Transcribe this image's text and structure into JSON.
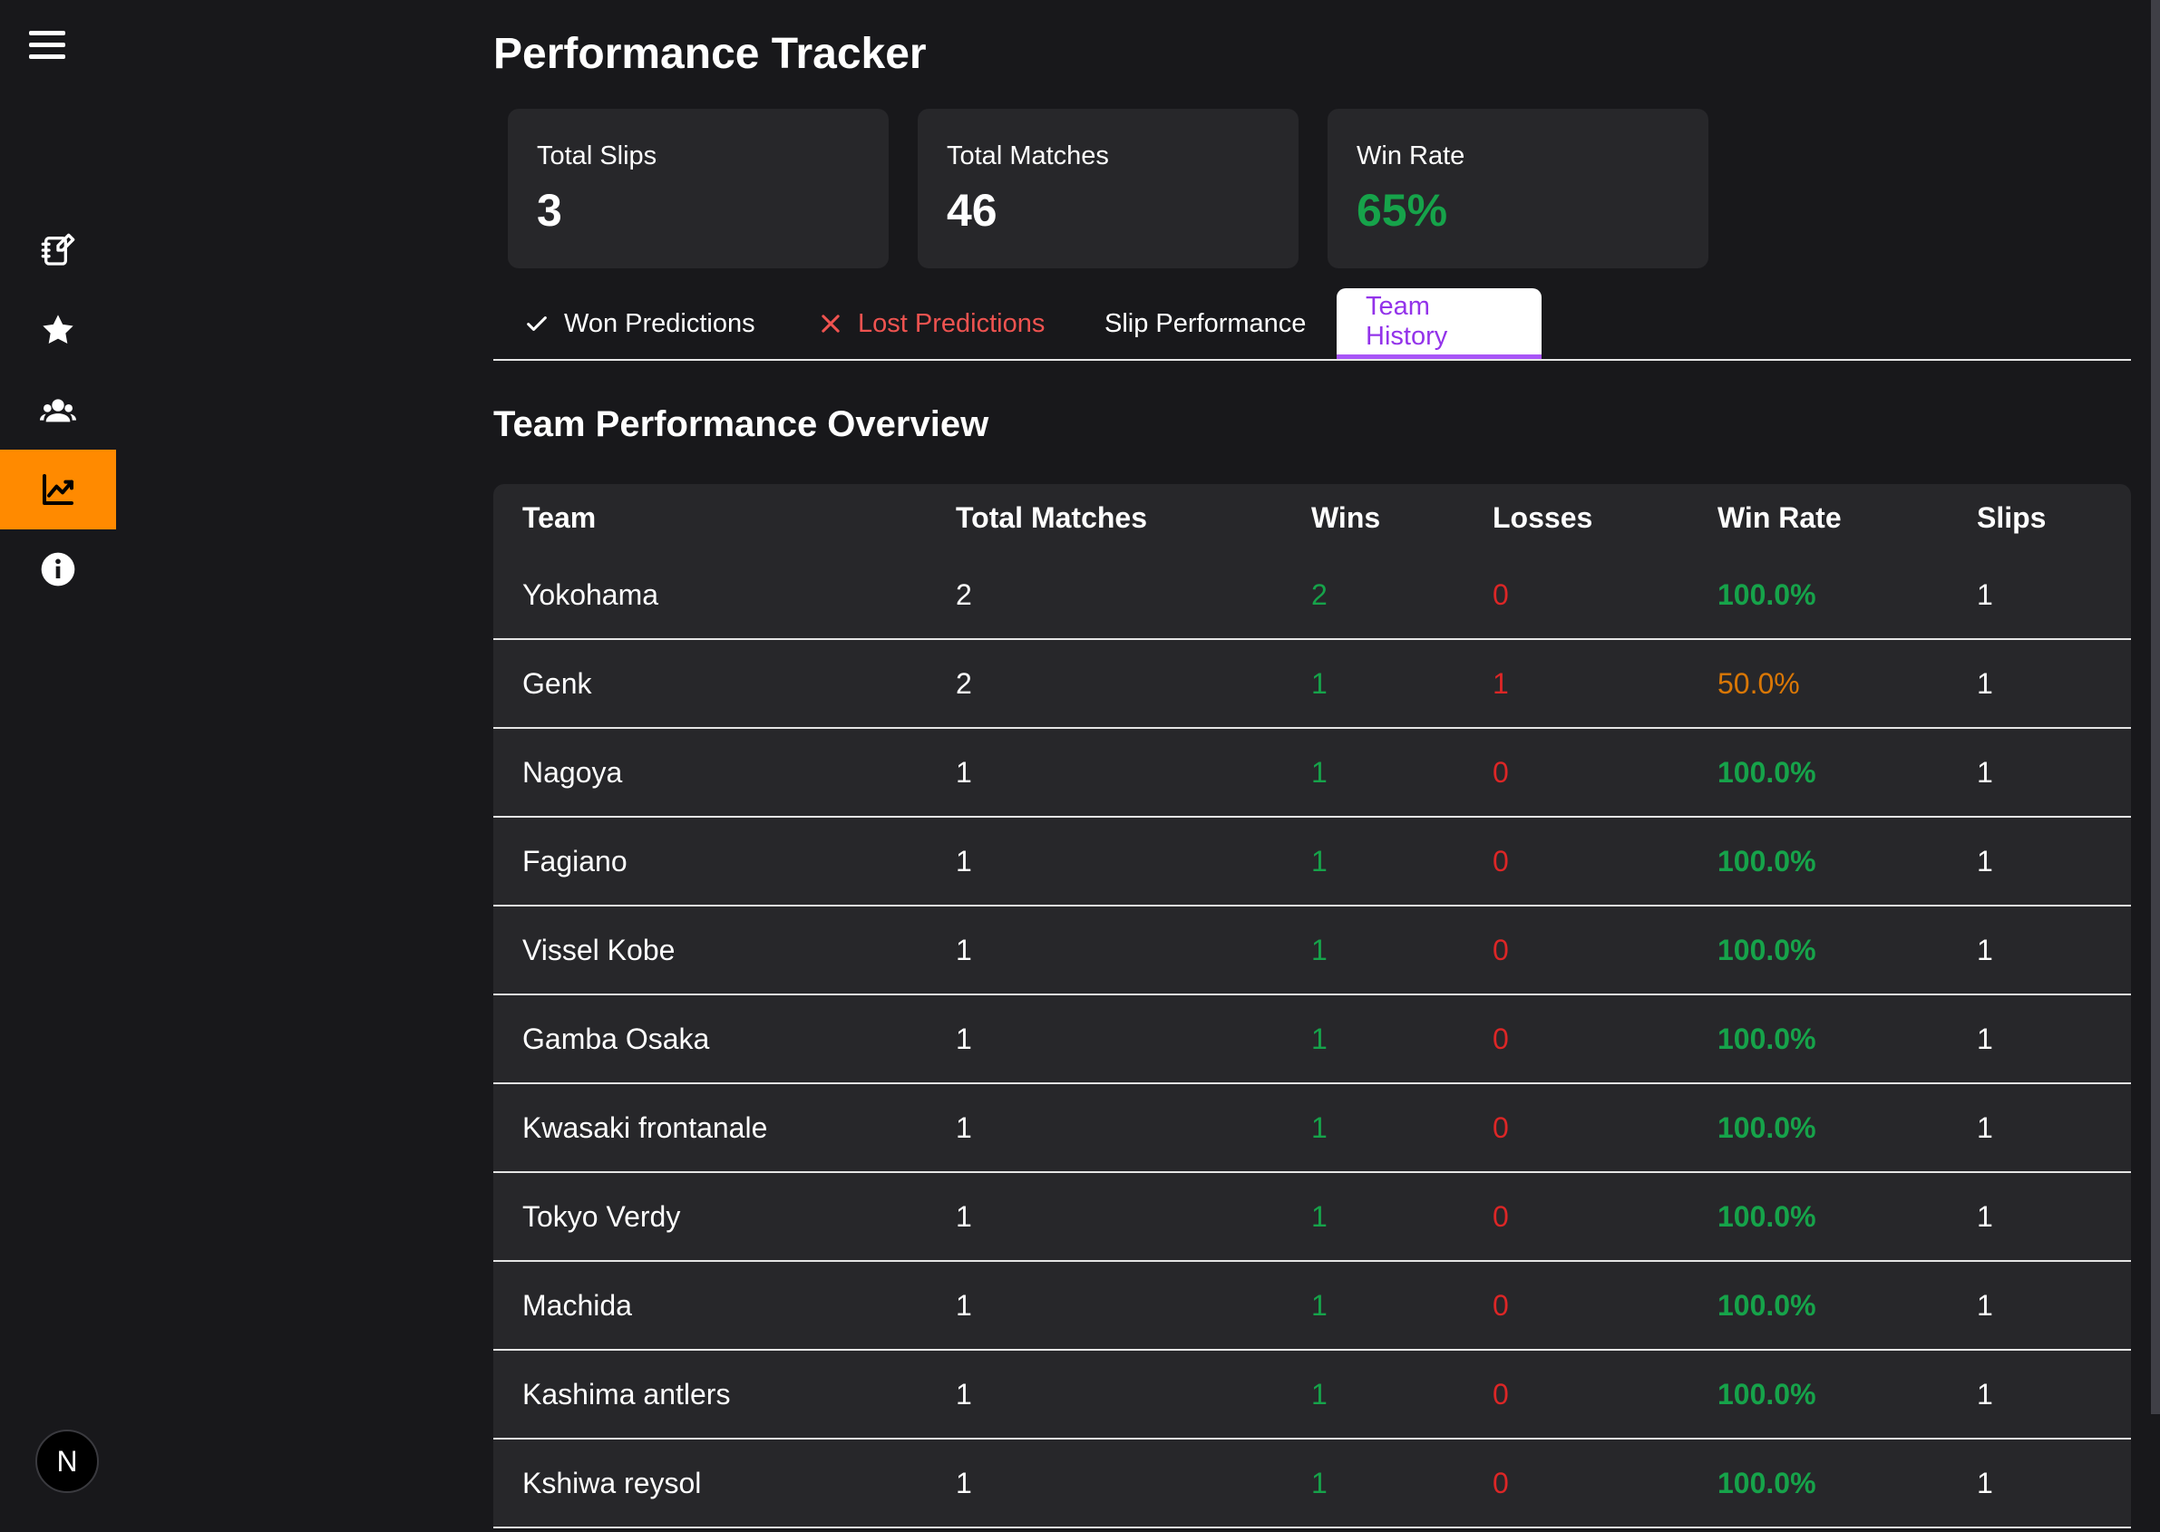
{
  "app": {
    "title": "Performance Tracker",
    "badge_letter": "N",
    "accent_color": "#ff8a00"
  },
  "sidebar": {
    "items": [
      {
        "icon": "edit-notes-icon",
        "active": false
      },
      {
        "icon": "star-icon",
        "active": false
      },
      {
        "icon": "group-icon",
        "active": false
      },
      {
        "icon": "trending-chart-icon",
        "active": true
      },
      {
        "icon": "info-icon",
        "active": false
      }
    ]
  },
  "stats": [
    {
      "label": "Total Slips",
      "value": "3"
    },
    {
      "label": "Total Matches",
      "value": "46"
    },
    {
      "label": "Win Rate",
      "value": "65%",
      "color": "#16a34a"
    }
  ],
  "tabs": [
    {
      "label": "Won Predictions",
      "icon": "check-icon"
    },
    {
      "label": "Lost Predictions",
      "icon": "close-icon"
    },
    {
      "label": "Slip Performance"
    },
    {
      "label": "Team History",
      "active": true
    }
  ],
  "section": {
    "title": "Team Performance Overview"
  },
  "table": {
    "headers": [
      "Team",
      "Total Matches",
      "Wins",
      "Losses",
      "Win Rate",
      "Slips"
    ],
    "rows": [
      {
        "team": "Yokohama",
        "matches": "2",
        "wins": "2",
        "losses": "0",
        "rate": "100.0%",
        "slips": "1"
      },
      {
        "team": "Genk",
        "matches": "2",
        "wins": "1",
        "losses": "1",
        "rate": "50.0%",
        "slips": "1"
      },
      {
        "team": "Nagoya",
        "matches": "1",
        "wins": "1",
        "losses": "0",
        "rate": "100.0%",
        "slips": "1"
      },
      {
        "team": "Fagiano",
        "matches": "1",
        "wins": "1",
        "losses": "0",
        "rate": "100.0%",
        "slips": "1"
      },
      {
        "team": "Vissel Kobe",
        "matches": "1",
        "wins": "1",
        "losses": "0",
        "rate": "100.0%",
        "slips": "1"
      },
      {
        "team": "Gamba Osaka",
        "matches": "1",
        "wins": "1",
        "losses": "0",
        "rate": "100.0%",
        "slips": "1"
      },
      {
        "team": "Kwasaki frontanale",
        "matches": "1",
        "wins": "1",
        "losses": "0",
        "rate": "100.0%",
        "slips": "1"
      },
      {
        "team": "Tokyo Verdy",
        "matches": "1",
        "wins": "1",
        "losses": "0",
        "rate": "100.0%",
        "slips": "1"
      },
      {
        "team": "Machida",
        "matches": "1",
        "wins": "1",
        "losses": "0",
        "rate": "100.0%",
        "slips": "1"
      },
      {
        "team": "Kashima antlers",
        "matches": "1",
        "wins": "1",
        "losses": "0",
        "rate": "100.0%",
        "slips": "1"
      },
      {
        "team": "Kshiwa reysol",
        "matches": "1",
        "wins": "1",
        "losses": "0",
        "rate": "100.0%",
        "slips": "1"
      }
    ]
  }
}
